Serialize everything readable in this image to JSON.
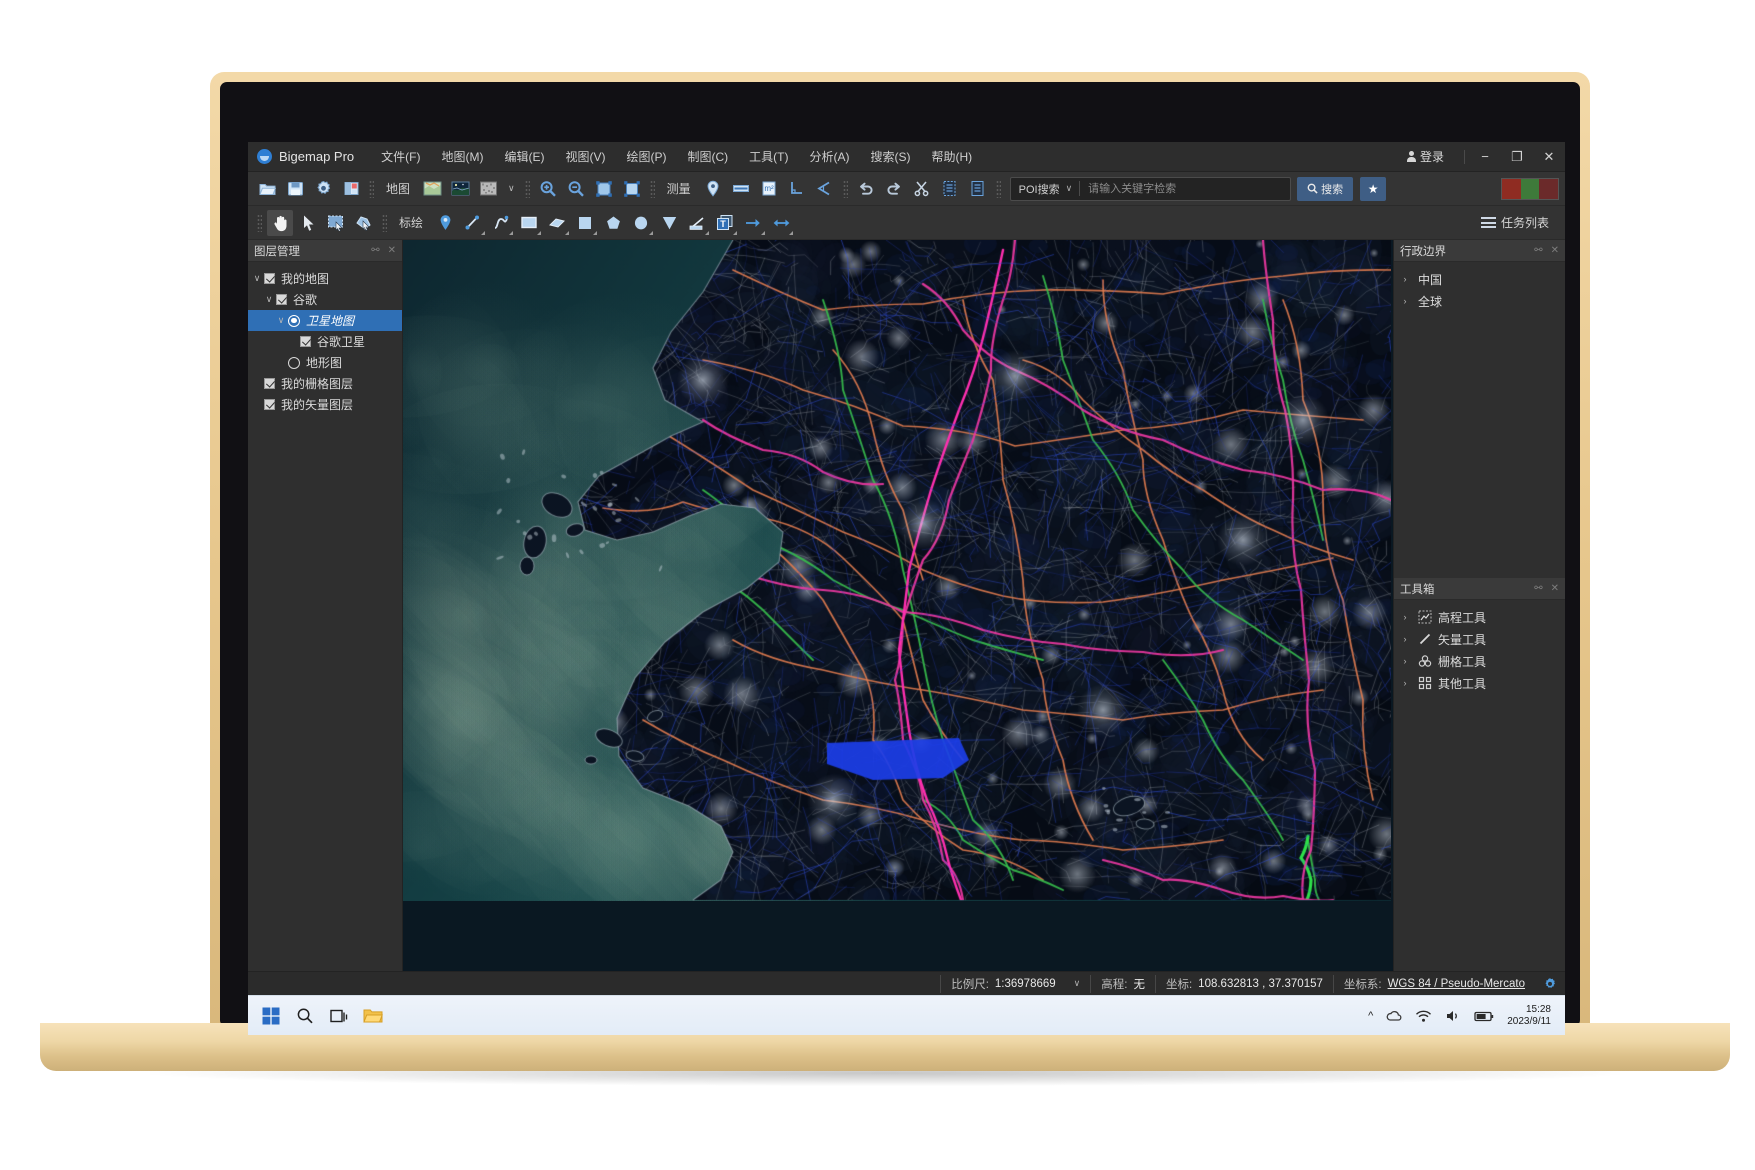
{
  "window": {
    "app_title": "Bigemap Pro",
    "logo_icon": "globe-icon",
    "menus": [
      {
        "label": "文件(F)",
        "name": "menu-file"
      },
      {
        "label": "地图(M)",
        "name": "menu-map"
      },
      {
        "label": "编辑(E)",
        "name": "menu-edit"
      },
      {
        "label": "视图(V)",
        "name": "menu-view"
      },
      {
        "label": "绘图(P)",
        "name": "menu-draw"
      },
      {
        "label": "制图(C)",
        "name": "menu-cartography"
      },
      {
        "label": "工具(T)",
        "name": "menu-tools"
      },
      {
        "label": "分析(A)",
        "name": "menu-analysis"
      },
      {
        "label": "搜索(S)",
        "name": "menu-search"
      },
      {
        "label": "帮助(H)",
        "name": "menu-help"
      }
    ],
    "login_label": "登录",
    "minimize_glyph": "−",
    "maximize_glyph": "❐",
    "close_glyph": "✕"
  },
  "toolbar_main": {
    "map_label": "地图",
    "measure_label": "测量",
    "dropdown_caret": "∨",
    "poi": {
      "type_label": "POI搜索",
      "type_caret": "∨",
      "placeholder": "请输入关键字检索",
      "value": "",
      "search_label": "搜索",
      "star_glyph": "★"
    },
    "icons": [
      "open-folder-icon",
      "save-icon",
      "settings-gear-icon",
      "layers-icon",
      "map-basemap-icon",
      "satellite-image-icon",
      "terrain-texture-icon",
      "zoom-in-icon",
      "zoom-out-icon",
      "zoom-to-selection-icon",
      "full-extent-icon",
      "measure-marker-icon",
      "measure-distance-icon",
      "measure-area-icon",
      "measure-vertical-icon",
      "measure-angle-icon",
      "undo-icon",
      "redo-icon",
      "cut-icon",
      "copy-icon",
      "paste-icon"
    ]
  },
  "toolbar_draw": {
    "annotate_label": "标绘",
    "task_list_label": "任务列表",
    "tools": [
      {
        "name": "pan-hand-tool",
        "active": true
      },
      {
        "name": "select-arrow-tool",
        "active": false
      },
      {
        "name": "rect-select-tool",
        "active": false
      },
      {
        "name": "node-edit-tool",
        "active": false
      },
      {
        "name": "place-marker-tool",
        "active": false
      },
      {
        "name": "draw-line-tool",
        "active": false
      },
      {
        "name": "draw-curve-tool",
        "active": false
      },
      {
        "name": "draw-rectangle-tool",
        "active": false
      },
      {
        "name": "draw-parallelogram-tool",
        "active": false
      },
      {
        "name": "draw-square-tool",
        "active": false
      },
      {
        "name": "draw-pentagon-tool",
        "active": false
      },
      {
        "name": "draw-circle-tool",
        "active": false
      },
      {
        "name": "draw-triangle-tool",
        "active": false
      },
      {
        "name": "draw-ruler-tool",
        "active": false
      },
      {
        "name": "text-label-tool",
        "active": false
      },
      {
        "name": "draw-arrow-tool",
        "active": false
      },
      {
        "name": "draw-double-arrow-tool",
        "active": false
      }
    ]
  },
  "layer_panel": {
    "title": "图层管理",
    "pin_glyph": "⚯",
    "close_glyph": "✕",
    "tree": [
      {
        "label": "我的地图",
        "indent": 0,
        "chev": "down",
        "ctl": "checkbox",
        "checked": true,
        "selected": false,
        "name": "layer-my-map"
      },
      {
        "label": "谷歌",
        "indent": 1,
        "chev": "down",
        "ctl": "checkbox",
        "checked": true,
        "selected": false,
        "name": "layer-google"
      },
      {
        "label": "卫星地图",
        "indent": 2,
        "chev": "down",
        "ctl": "radio-on",
        "checked": true,
        "selected": true,
        "name": "layer-satellite-map"
      },
      {
        "label": "谷歌卫星",
        "indent": 3,
        "chev": "none",
        "ctl": "checkbox",
        "checked": true,
        "selected": false,
        "name": "layer-google-satellite"
      },
      {
        "label": "地形图",
        "indent": 2,
        "chev": "none",
        "ctl": "radio-off",
        "checked": false,
        "selected": false,
        "name": "layer-terrain-map"
      },
      {
        "label": "我的栅格图层",
        "indent": 0,
        "chev": "none",
        "ctl": "checkbox",
        "checked": true,
        "selected": false,
        "name": "layer-my-raster"
      },
      {
        "label": "我的矢量图层",
        "indent": 0,
        "chev": "none",
        "ctl": "checkbox",
        "checked": true,
        "selected": false,
        "name": "layer-my-vector"
      }
    ]
  },
  "boundary_panel": {
    "title": "行政边界",
    "items": [
      {
        "label": "中国",
        "name": "boundary-china"
      },
      {
        "label": "全球",
        "name": "boundary-global"
      }
    ]
  },
  "toolbox_panel": {
    "title": "工具箱",
    "items": [
      {
        "label": "高程工具",
        "icon": "elevation-tool-icon",
        "name": "toolbox-elevation"
      },
      {
        "label": "矢量工具",
        "icon": "vector-tool-icon",
        "name": "toolbox-vector"
      },
      {
        "label": "栅格工具",
        "icon": "raster-tool-icon",
        "name": "toolbox-raster"
      },
      {
        "label": "其他工具",
        "icon": "other-tool-icon",
        "name": "toolbox-other"
      }
    ]
  },
  "statusbar": {
    "scale_key": "比例尺:",
    "scale_value": "1:36978669",
    "scale_caret": "∨",
    "elevation_key": "高程:",
    "elevation_value": "无",
    "coord_key": "坐标:",
    "coord_value": "108.632813 , 37.370157",
    "crs_key": "坐标系:",
    "crs_value": "WGS 84 / Pseudo-Mercato",
    "settings_icon": "gear-icon"
  },
  "taskbar": {
    "apps": [
      "windows-start-icon",
      "search-icon",
      "task-view-icon",
      "file-explorer-icon"
    ],
    "tray": [
      "chevron-up-icon",
      "onedrive-icon",
      "wifi-icon",
      "volume-icon",
      "battery-icon"
    ],
    "time": "15:28",
    "date": "2023/9/11"
  },
  "colors": {
    "accent": "#2f6fb5",
    "toolbar_accent": "#3f5e85",
    "panel_bg": "#2f2f2f",
    "window_bg": "#2b2b2b",
    "sea": "#14333b",
    "land": "#070b14"
  }
}
